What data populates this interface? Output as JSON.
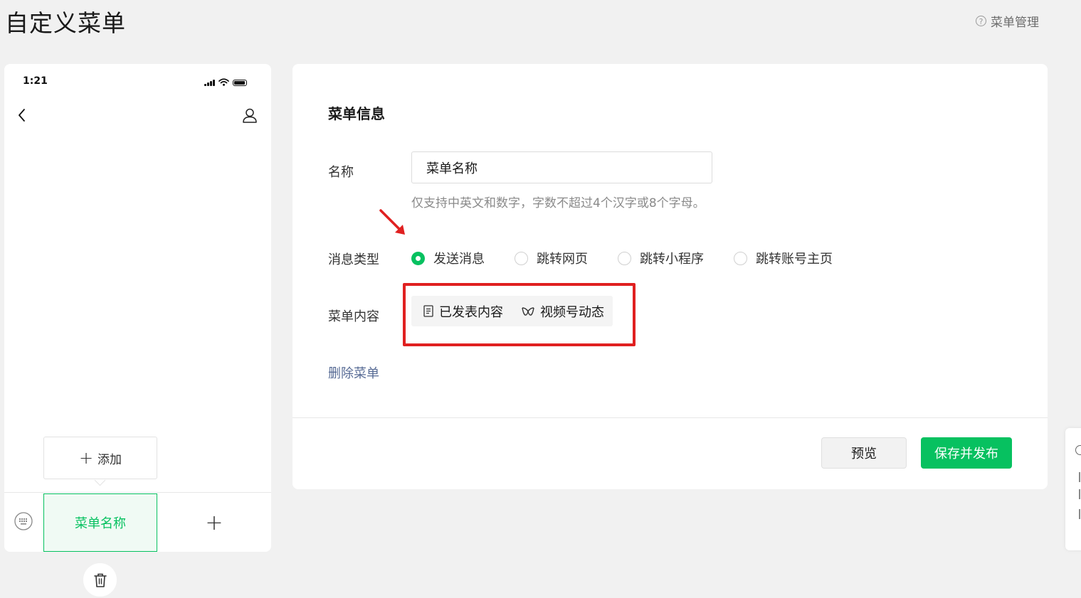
{
  "header": {
    "title": "自定义菜单",
    "help_label": "菜单管理",
    "help_icon_glyph": "?"
  },
  "phone": {
    "status_time": "1:21",
    "add_popup": {
      "plus": "+",
      "label": "添加"
    },
    "menu_tab_label": "菜单名称",
    "menu_add_glyph": "+"
  },
  "form": {
    "section_title": "菜单信息",
    "name": {
      "label": "名称",
      "value": "菜单名称",
      "hint": "仅支持中英文和数字，字数不超过4个汉字或8个字母。"
    },
    "message_type": {
      "label": "消息类型",
      "options": [
        {
          "label": "发送消息",
          "selected": true
        },
        {
          "label": "跳转网页",
          "selected": false
        },
        {
          "label": "跳转小程序",
          "selected": false
        },
        {
          "label": "跳转账号主页",
          "selected": false
        }
      ]
    },
    "menu_content": {
      "label": "菜单内容",
      "items": [
        {
          "label": "已发表内容",
          "icon": "document-icon"
        },
        {
          "label": "视频号动态",
          "icon": "channels-icon"
        }
      ]
    },
    "delete_label": "删除菜单"
  },
  "footer": {
    "preview_label": "预览",
    "publish_label": "保存并发布"
  },
  "colors": {
    "accent": "#07c160",
    "link": "#576b95",
    "annotation": "#e02020"
  }
}
